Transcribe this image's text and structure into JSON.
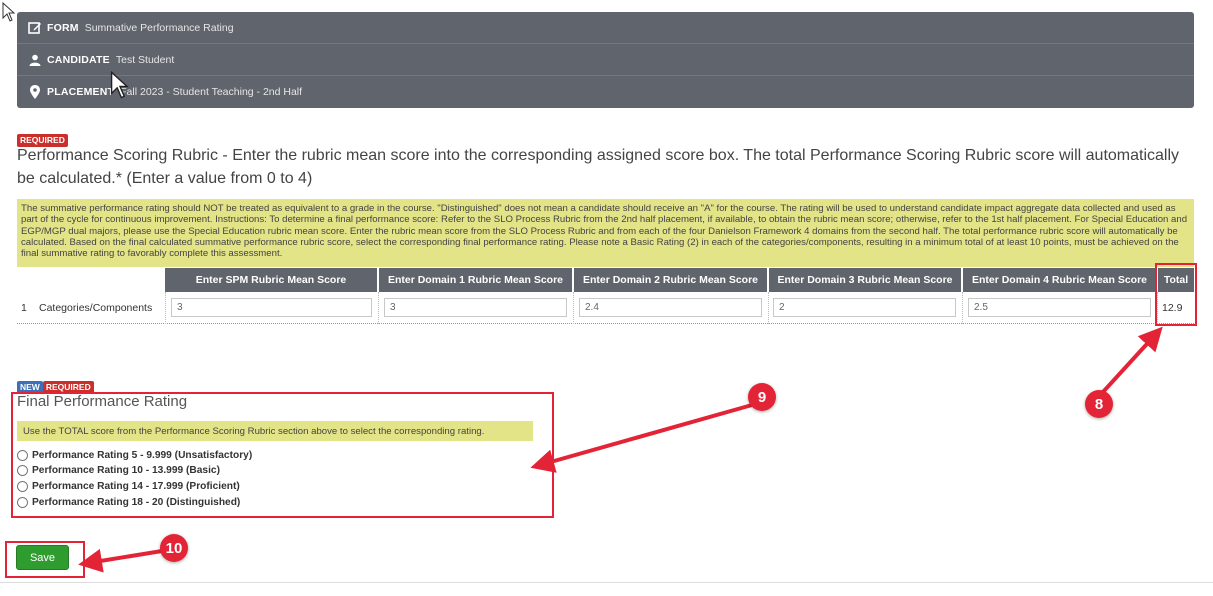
{
  "header": {
    "form_label": "FORM",
    "form_value": "Summative Performance Rating",
    "candidate_label": "CANDIDATE",
    "candidate_value": "Test Student",
    "placement_label": "PLACEMENT",
    "placement_value": "Fall 2023 - Student Teaching - 2nd Half"
  },
  "rubric_section": {
    "required_badge": "REQUIRED",
    "title": "Performance Scoring Rubric - Enter the rubric mean score into the corresponding assigned score box. The total Performance Scoring Rubric score will automatically be calculated.* (Enter a value from 0 to 4)",
    "note": "The summative performance rating should NOT be treated as equivalent to a grade in the course. \"Distinguished\" does not mean a candidate should receive an \"A\" for the course. The rating will be used to understand candidate impact aggregate data collected and used as part of the cycle for continuous improvement. Instructions: To determine a final performance score: Refer to the SLO Process Rubric from the 2nd half placement, if available, to obtain the rubric mean score; otherwise, refer to the 1st half placement. For Special Education and EGP/MGP dual majors, please use the Special Education rubric mean score. Enter the rubric mean score from the SLO Process Rubric and from each of the four Danielson Framework 4 domains from the second half. The total performance rubric score will automatically be calculated. Based on the final calculated summative performance rubric score, select the corresponding final performance rating. Please note a Basic Rating (2) in each of the categories/components, resulting in a minimum total of at least 10 points, must be achieved on the final summative rating to favorably complete this assessment.",
    "columns": [
      "Enter SPM Rubric Mean Score",
      "Enter Domain 1 Rubric Mean Score",
      "Enter Domain 2 Rubric Mean Score",
      "Enter Domain 3 Rubric Mean Score",
      "Enter Domain 4 Rubric Mean Score",
      "Total"
    ],
    "row": {
      "number": "1",
      "label": "Categories/Components",
      "values": [
        "3",
        "3",
        "2.4",
        "2",
        "2.5"
      ],
      "total": "12.9"
    }
  },
  "final_rating": {
    "new_badge": "NEW",
    "required_badge": "REQUIRED",
    "title": "Final Performance Rating",
    "note": "Use the TOTAL score from the Performance Scoring Rubric section above to select the corresponding rating.",
    "options": [
      "Performance Rating 5 - 9.999 (Unsatisfactory)",
      "Performance Rating 10 - 13.999 (Basic)",
      "Performance Rating 14 - 17.999 (Proficient)",
      "Performance Rating 18 - 20 (Distinguished)"
    ]
  },
  "save_label": "Save",
  "callouts": {
    "c8": "8",
    "c9": "9",
    "c10": "10"
  },
  "colors": {
    "accent_red": "#e32437",
    "header_gray": "#60646d",
    "note_yellow": "#e3e388",
    "save_green": "#2f9c2f"
  }
}
